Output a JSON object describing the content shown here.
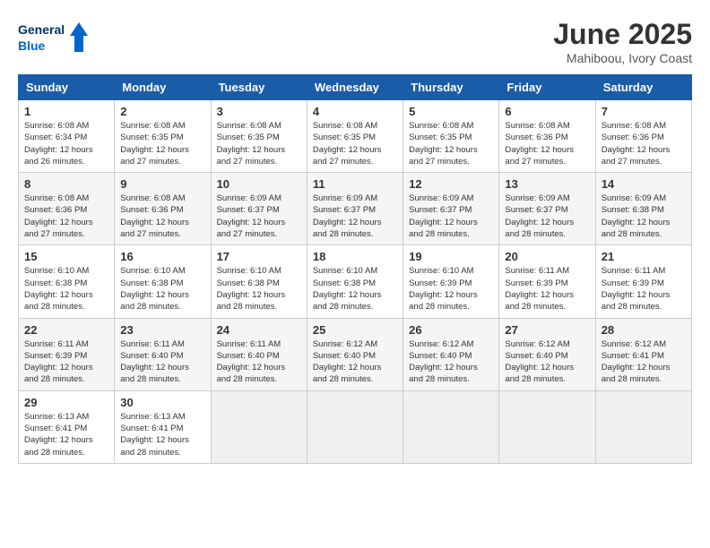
{
  "header": {
    "logo_line1": "General",
    "logo_line2": "Blue",
    "title": "June 2025",
    "subtitle": "Mahiboou, Ivory Coast"
  },
  "weekdays": [
    "Sunday",
    "Monday",
    "Tuesday",
    "Wednesday",
    "Thursday",
    "Friday",
    "Saturday"
  ],
  "weeks": [
    [
      {
        "day": "1",
        "sunrise": "6:08 AM",
        "sunset": "6:34 PM",
        "daylight": "12 hours and 26 minutes."
      },
      {
        "day": "2",
        "sunrise": "6:08 AM",
        "sunset": "6:35 PM",
        "daylight": "12 hours and 27 minutes."
      },
      {
        "day": "3",
        "sunrise": "6:08 AM",
        "sunset": "6:35 PM",
        "daylight": "12 hours and 27 minutes."
      },
      {
        "day": "4",
        "sunrise": "6:08 AM",
        "sunset": "6:35 PM",
        "daylight": "12 hours and 27 minutes."
      },
      {
        "day": "5",
        "sunrise": "6:08 AM",
        "sunset": "6:35 PM",
        "daylight": "12 hours and 27 minutes."
      },
      {
        "day": "6",
        "sunrise": "6:08 AM",
        "sunset": "6:36 PM",
        "daylight": "12 hours and 27 minutes."
      },
      {
        "day": "7",
        "sunrise": "6:08 AM",
        "sunset": "6:36 PM",
        "daylight": "12 hours and 27 minutes."
      }
    ],
    [
      {
        "day": "8",
        "sunrise": "6:08 AM",
        "sunset": "6:36 PM",
        "daylight": "12 hours and 27 minutes."
      },
      {
        "day": "9",
        "sunrise": "6:08 AM",
        "sunset": "6:36 PM",
        "daylight": "12 hours and 27 minutes."
      },
      {
        "day": "10",
        "sunrise": "6:09 AM",
        "sunset": "6:37 PM",
        "daylight": "12 hours and 27 minutes."
      },
      {
        "day": "11",
        "sunrise": "6:09 AM",
        "sunset": "6:37 PM",
        "daylight": "12 hours and 28 minutes."
      },
      {
        "day": "12",
        "sunrise": "6:09 AM",
        "sunset": "6:37 PM",
        "daylight": "12 hours and 28 minutes."
      },
      {
        "day": "13",
        "sunrise": "6:09 AM",
        "sunset": "6:37 PM",
        "daylight": "12 hours and 28 minutes."
      },
      {
        "day": "14",
        "sunrise": "6:09 AM",
        "sunset": "6:38 PM",
        "daylight": "12 hours and 28 minutes."
      }
    ],
    [
      {
        "day": "15",
        "sunrise": "6:10 AM",
        "sunset": "6:38 PM",
        "daylight": "12 hours and 28 minutes."
      },
      {
        "day": "16",
        "sunrise": "6:10 AM",
        "sunset": "6:38 PM",
        "daylight": "12 hours and 28 minutes."
      },
      {
        "day": "17",
        "sunrise": "6:10 AM",
        "sunset": "6:38 PM",
        "daylight": "12 hours and 28 minutes."
      },
      {
        "day": "18",
        "sunrise": "6:10 AM",
        "sunset": "6:38 PM",
        "daylight": "12 hours and 28 minutes."
      },
      {
        "day": "19",
        "sunrise": "6:10 AM",
        "sunset": "6:39 PM",
        "daylight": "12 hours and 28 minutes."
      },
      {
        "day": "20",
        "sunrise": "6:11 AM",
        "sunset": "6:39 PM",
        "daylight": "12 hours and 28 minutes."
      },
      {
        "day": "21",
        "sunrise": "6:11 AM",
        "sunset": "6:39 PM",
        "daylight": "12 hours and 28 minutes."
      }
    ],
    [
      {
        "day": "22",
        "sunrise": "6:11 AM",
        "sunset": "6:39 PM",
        "daylight": "12 hours and 28 minutes."
      },
      {
        "day": "23",
        "sunrise": "6:11 AM",
        "sunset": "6:40 PM",
        "daylight": "12 hours and 28 minutes."
      },
      {
        "day": "24",
        "sunrise": "6:11 AM",
        "sunset": "6:40 PM",
        "daylight": "12 hours and 28 minutes."
      },
      {
        "day": "25",
        "sunrise": "6:12 AM",
        "sunset": "6:40 PM",
        "daylight": "12 hours and 28 minutes."
      },
      {
        "day": "26",
        "sunrise": "6:12 AM",
        "sunset": "6:40 PM",
        "daylight": "12 hours and 28 minutes."
      },
      {
        "day": "27",
        "sunrise": "6:12 AM",
        "sunset": "6:40 PM",
        "daylight": "12 hours and 28 minutes."
      },
      {
        "day": "28",
        "sunrise": "6:12 AM",
        "sunset": "6:41 PM",
        "daylight": "12 hours and 28 minutes."
      }
    ],
    [
      {
        "day": "29",
        "sunrise": "6:13 AM",
        "sunset": "6:41 PM",
        "daylight": "12 hours and 28 minutes."
      },
      {
        "day": "30",
        "sunrise": "6:13 AM",
        "sunset": "6:41 PM",
        "daylight": "12 hours and 28 minutes."
      },
      null,
      null,
      null,
      null,
      null
    ]
  ]
}
